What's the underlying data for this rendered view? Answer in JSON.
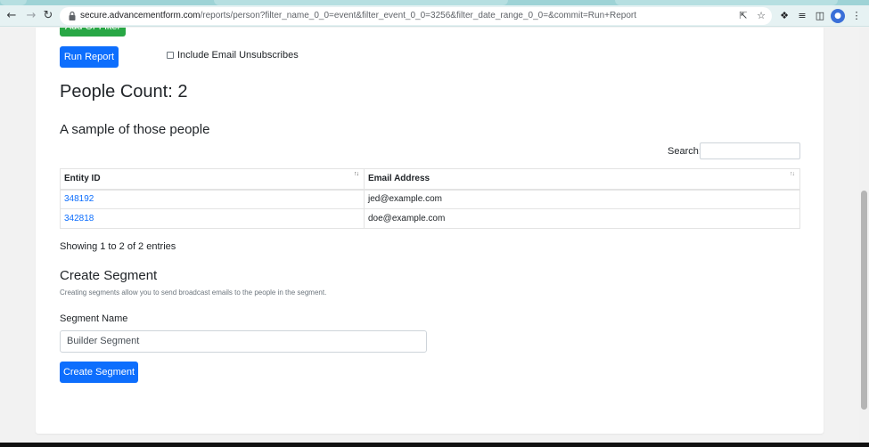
{
  "browser": {
    "url_host": "secure.advancementform.com",
    "url_path": "/reports/person?filter_name_0_0=event&filter_event_0_0=3256&filter_date_range_0_0=&commit=Run+Report",
    "icons": {
      "back": "arrow-left-icon",
      "forward": "arrow-right-icon",
      "reload": "reload-icon",
      "lock": "lock-icon",
      "share": "share-icon",
      "bookmark": "star-icon",
      "extensions": "puzzle-icon",
      "media": "playlist-icon",
      "sidepanel": "sidepanel-icon",
      "profile": "avatar-icon",
      "menu": "kebab-menu-icon"
    }
  },
  "filters": {
    "add_or_filter_label": "Add Or Filter",
    "run_report_label": "Run Report",
    "include_unsubscribes_label": "Include Email Unsubscribes",
    "include_unsubscribes_checked": false
  },
  "results": {
    "people_count_title": "People Count: 2",
    "sample_title": "A sample of those people",
    "search_label": "Search:",
    "search_value": "",
    "columns": [
      "Entity ID",
      "Email Address"
    ],
    "rows": [
      {
        "entity_id": "348192",
        "email": "jed@example.com"
      },
      {
        "entity_id": "342818",
        "email": "doe@example.com"
      }
    ],
    "info_text": "Showing 1 to 2 of 2 entries"
  },
  "segment": {
    "title": "Create Segment",
    "description": "Creating segments allow you to send broadcast emails to the people in the segment.",
    "name_label": "Segment Name",
    "name_value": "Builder Segment",
    "create_label": "Create Segment"
  },
  "colors": {
    "primary": "#0d6efd",
    "success": "#28a745",
    "link": "#0d6efd"
  }
}
